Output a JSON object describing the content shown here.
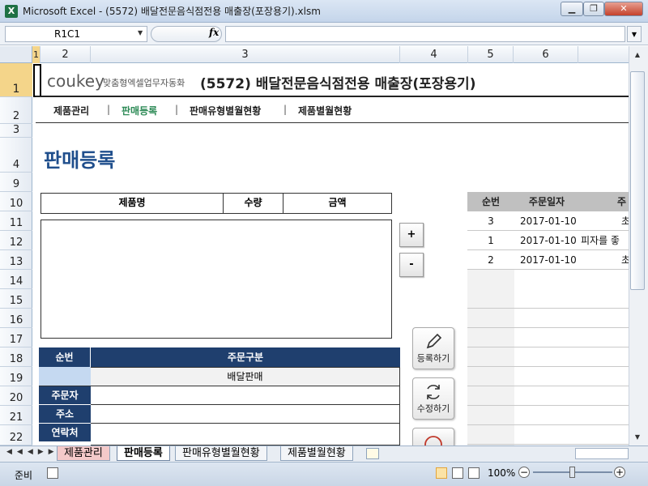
{
  "window": {
    "title": "Microsoft Excel - (5572) 배달전문음식점전용 매출장(포장용기).xlsm",
    "app_icon": "X",
    "minimize": "▁",
    "restore": "❐",
    "close": "✕"
  },
  "formula_bar": {
    "name_box": "R1C1",
    "fx": "fx",
    "value": ""
  },
  "columns": [
    "1",
    "2",
    "3",
    "4",
    "5",
    "6"
  ],
  "rows": [
    "1",
    "2",
    "3",
    "4",
    "9",
    "10",
    "11",
    "12",
    "13",
    "14",
    "15",
    "16",
    "17",
    "18",
    "19",
    "20",
    "21",
    "22"
  ],
  "brand": {
    "logo": "coukey",
    "tagline": "맞춤형엑셀업무자동화"
  },
  "doc_title": "(5572) 배달전문음식점전용 매출장(포장용기)",
  "nav": {
    "items": [
      "제품관리",
      "판매등록",
      "판매유형별월현황",
      "제품별월현황"
    ],
    "sep": "|"
  },
  "section_title": "판매등록",
  "product_table": {
    "headers": [
      "제품명",
      "수량",
      "금액"
    ]
  },
  "buttons": {
    "add": "+",
    "remove": "-",
    "register": "등록하기",
    "modify": "수정하기"
  },
  "order_form": {
    "headers": [
      "순번",
      "주문구분"
    ],
    "order_type_value": "배달판매",
    "labels": [
      "주문자",
      "주소",
      "연락처"
    ]
  },
  "order_list": {
    "headers": [
      "순번",
      "주문일자",
      "주"
    ],
    "rows": [
      {
        "no": "3",
        "date": "2017-01-10",
        "item": "초"
      },
      {
        "no": "1",
        "date": "2017-01-10",
        "item": "피자를 좋"
      },
      {
        "no": "2",
        "date": "2017-01-10",
        "item": "초"
      }
    ]
  },
  "sheet_tabs": [
    "제품관리",
    "판매등록",
    "판매유형별월현황",
    "제품별월현황"
  ],
  "status": {
    "ready": "준비",
    "zoom": "100%",
    "zoom_minus": "−",
    "zoom_plus": "+"
  },
  "colors": {
    "accent": "#1f3f6e",
    "title": "#1f4e8c",
    "green": "#2e8b57"
  }
}
